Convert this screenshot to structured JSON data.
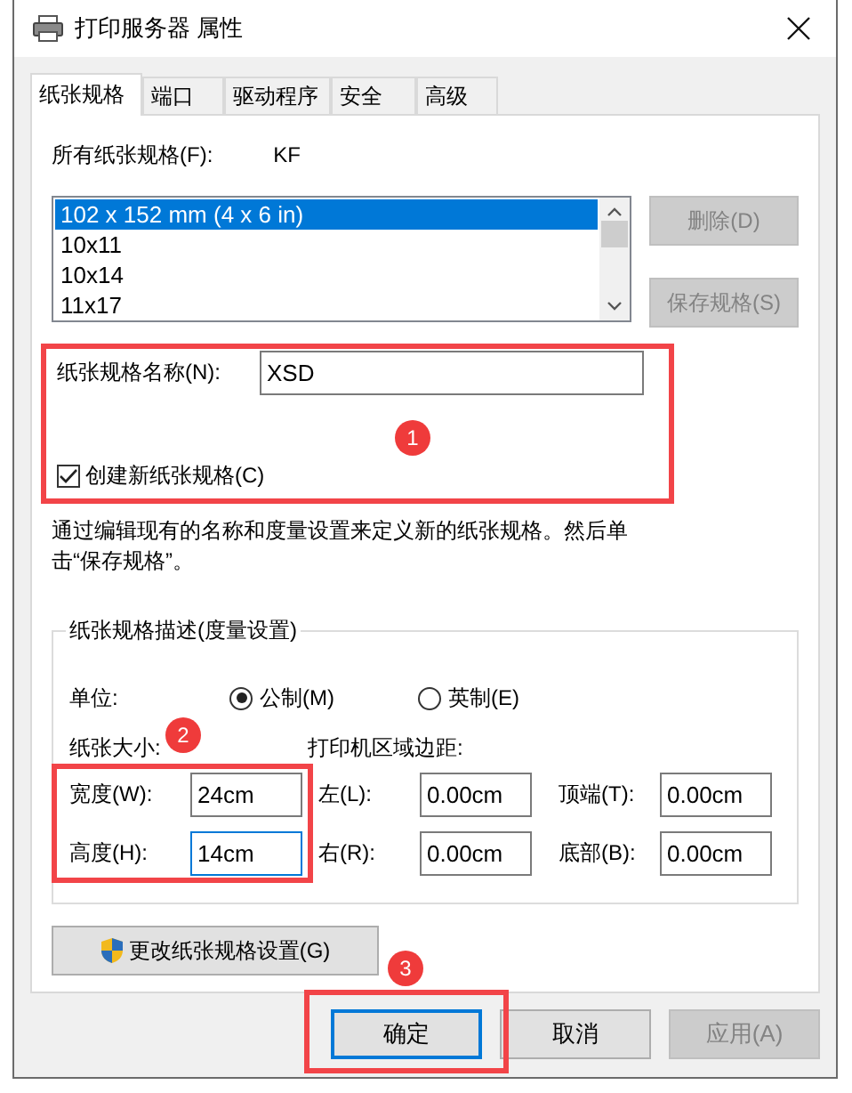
{
  "window": {
    "title": "打印服务器 属性"
  },
  "tabs": [
    {
      "label": "纸张规格",
      "selected": true
    },
    {
      "label": "端口",
      "selected": false
    },
    {
      "label": "驱动程序",
      "selected": false
    },
    {
      "label": "安全",
      "selected": false
    },
    {
      "label": "高级",
      "selected": false
    }
  ],
  "forms_label": "所有纸张规格(F):",
  "current_form": "KF",
  "forms_list": [
    {
      "label": "102 x 152 mm (4 x 6 in)",
      "selected": true
    },
    {
      "label": "10x11",
      "selected": false
    },
    {
      "label": "10x14",
      "selected": false
    },
    {
      "label": "11x17",
      "selected": false
    }
  ],
  "side_buttons": [
    {
      "label": "删除(D)",
      "disabled": true
    },
    {
      "label": "保存规格(S)",
      "disabled": true
    }
  ],
  "form_name": {
    "label": "纸张规格名称(N):",
    "value": "XSD"
  },
  "create_new": {
    "label": "创建新纸张规格(C)",
    "checked": true
  },
  "hint": "通过编辑现有的名称和度量设置来定义新的纸张规格。然后单击“保存规格”。",
  "description": {
    "title": "纸张规格描述(度量设置)",
    "units_label": "单位:",
    "units": [
      {
        "label": "公制(M)",
        "selected": true
      },
      {
        "label": "英制(E)",
        "selected": false
      }
    ],
    "paper_size_label": "纸张大小:",
    "margins_label": "打印机区域边距:",
    "size_fields": [
      {
        "label": "宽度(W):",
        "value": "24cm",
        "focused": false
      },
      {
        "label": "高度(H):",
        "value": "14cm",
        "focused": true
      }
    ],
    "margin_fields": [
      {
        "label": "左(L):",
        "value": "0.00cm"
      },
      {
        "label": "顶端(T):",
        "value": "0.00cm"
      },
      {
        "label": "右(R):",
        "value": "0.00cm"
      },
      {
        "label": "底部(B):",
        "value": "0.00cm"
      }
    ]
  },
  "change_button": "更改纸张规格设置(G)",
  "buttons": [
    {
      "label": "确定",
      "default": true,
      "disabled": false
    },
    {
      "label": "取消",
      "default": false,
      "disabled": false
    },
    {
      "label": "应用(A)",
      "default": false,
      "disabled": true
    }
  ],
  "annotations": [
    {
      "number": "1"
    },
    {
      "number": "2"
    },
    {
      "number": "3"
    }
  ]
}
